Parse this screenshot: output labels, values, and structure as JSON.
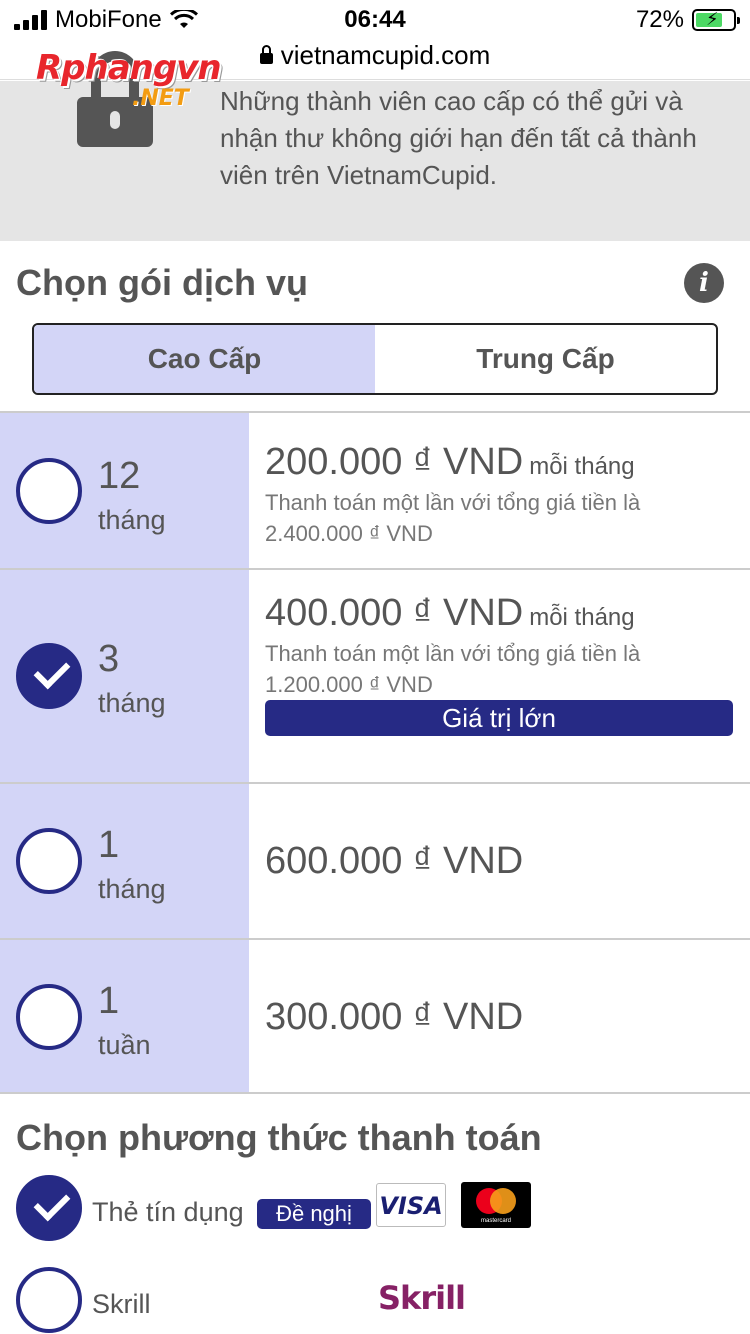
{
  "status": {
    "carrier": "MobiFone",
    "time": "06:44",
    "battery": "72%"
  },
  "browser": {
    "url": "vietnamcupid.com"
  },
  "watermark": {
    "main": "Rphangvn",
    "sub": ".NET"
  },
  "banner": {
    "text": "Những thành viên cao cấp có thể gửi và nhận thư không giới hạn đến tất cả thành viên trên VietnamCupid."
  },
  "plan_section": {
    "title": "Chọn gói dịch vụ",
    "info_icon": "i",
    "tabs": [
      {
        "label": "Cao Cấp",
        "active": true
      },
      {
        "label": "Trung Cấp",
        "active": false
      }
    ]
  },
  "plans": [
    {
      "number": "12",
      "unit": "tháng",
      "price": "200.000 ₫ VND",
      "per": "mỗi tháng",
      "note": "Thanh toán một lần với tổng giá tiền là 2.400.000 ₫ VND",
      "badge": "",
      "checked": false
    },
    {
      "number": "3",
      "unit": "tháng",
      "price": "400.000 ₫ VND",
      "per": "mỗi tháng",
      "note": "Thanh toán một lần với tổng giá tiền là 1.200.000 ₫ VND",
      "badge": "Giá trị lớn",
      "checked": true
    },
    {
      "number": "1",
      "unit": "tháng",
      "price": "600.000 ₫ VND",
      "per": "",
      "note": "",
      "badge": "",
      "checked": false
    },
    {
      "number": "1",
      "unit": "tuần",
      "price": "300.000 ₫ VND",
      "per": "",
      "note": "",
      "badge": "",
      "checked": false
    }
  ],
  "payment": {
    "title": "Chọn phương thức thanh toán",
    "methods": [
      {
        "label": "Thẻ tín dụng",
        "badge": "Đề nghị",
        "logos": [
          "VISA",
          "mastercard"
        ],
        "checked": true
      },
      {
        "label": "Skrill",
        "logos": [
          "Skrill"
        ],
        "checked": false
      }
    ]
  },
  "colors": {
    "accent": "#262a85",
    "plan_bg": "#d3d5f7",
    "banner_bg": "#e5e5e5"
  }
}
